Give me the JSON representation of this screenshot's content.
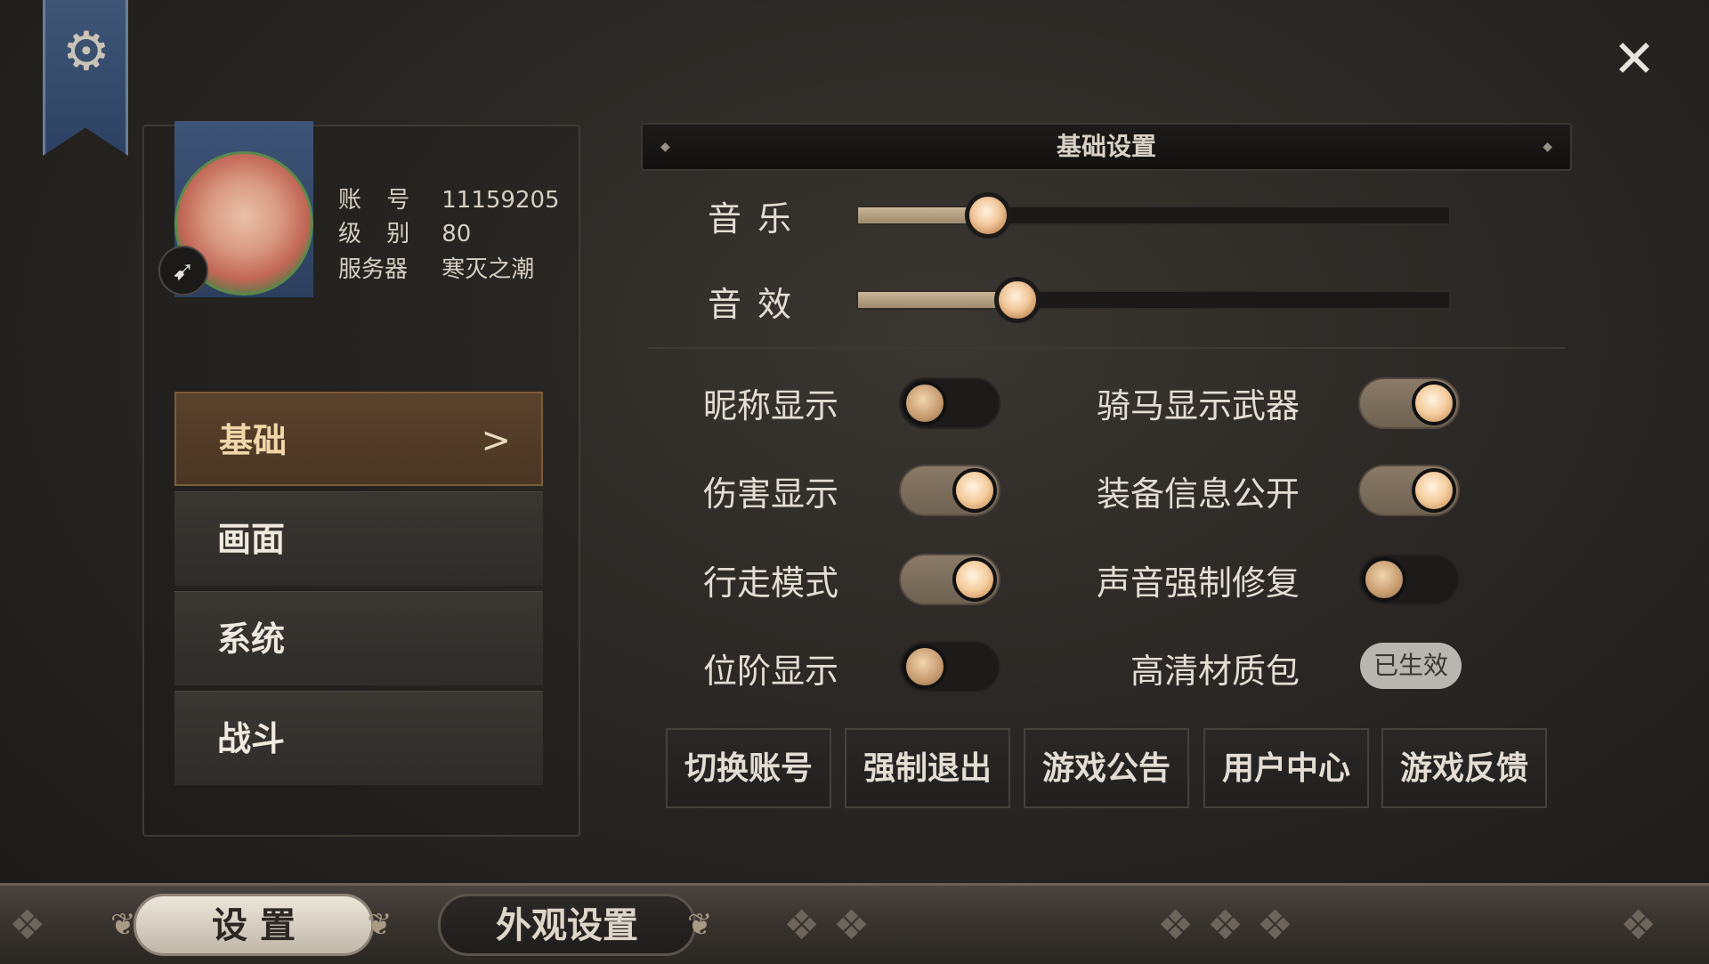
{
  "icons": {
    "settings": "gear-icon",
    "close": "close-icon",
    "class": "bow-icon"
  },
  "player": {
    "account_label": "账 号",
    "account_value": "11159205",
    "level_label": "级 别",
    "level_value": "80",
    "server_label": "服务器",
    "server_value": "寒灭之潮"
  },
  "nav": {
    "items": [
      {
        "label": "基础",
        "active": true
      },
      {
        "label": "画面",
        "active": false
      },
      {
        "label": "系统",
        "active": false
      },
      {
        "label": "战斗",
        "active": false
      }
    ],
    "active_arrow": ">"
  },
  "section": {
    "title": "基础设置"
  },
  "sliders": [
    {
      "label": "音乐",
      "value_percent": 22
    },
    {
      "label": "音效",
      "value_percent": 27
    }
  ],
  "toggles": {
    "left": [
      {
        "label": "昵称显示",
        "on": false
      },
      {
        "label": "伤害显示",
        "on": true
      },
      {
        "label": "行走模式",
        "on": true
      },
      {
        "label": "位阶显示",
        "on": false
      }
    ],
    "right": [
      {
        "label": "骑马显示武器",
        "on": true
      },
      {
        "label": "装备信息公开",
        "on": true
      },
      {
        "label": "声音强制修复",
        "on": false
      },
      {
        "label": "高清材质包",
        "status": "已生效"
      }
    ]
  },
  "actions": [
    "切换账号",
    "强制退出",
    "游戏公告",
    "用户中心",
    "游戏反馈"
  ],
  "bottom_tabs": [
    {
      "label": "设 置",
      "active": true
    },
    {
      "label": "外观设置",
      "active": false
    }
  ],
  "colors": {
    "background": "#2a2724",
    "accent_gold": "#c8b597",
    "active_nav": "#5a422c",
    "banner_blue": "#3f5677"
  }
}
